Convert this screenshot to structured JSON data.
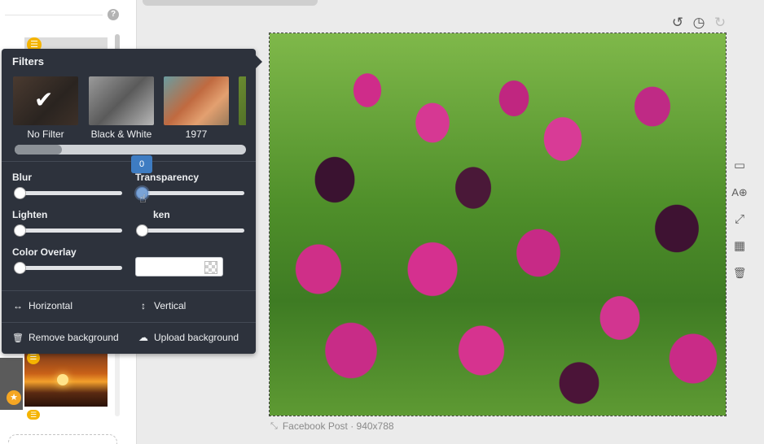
{
  "sidebar": {
    "help_icon": "?",
    "badge_icon": "☰",
    "star_icon": "★"
  },
  "history": {
    "undo_icon": "↺",
    "history_icon": "◷",
    "redo_icon": "↻"
  },
  "canvas": {
    "caption_icon": "⤡",
    "caption": "Facebook Post · 940x788"
  },
  "tools": {
    "page_icon": "▭",
    "text_icon": "A⊕",
    "resize_icon": "⤢",
    "grid_icon": "▦",
    "trash_icon": "🗑"
  },
  "filters_panel": {
    "title": "Filters",
    "filters": [
      {
        "name": "No Filter",
        "selected": true
      },
      {
        "name": "Black & White",
        "selected": false
      },
      {
        "name": "1977",
        "selected": false
      },
      {
        "name": "",
        "selected": false
      }
    ],
    "check_icon": "✔",
    "adjustments": {
      "blur": {
        "label": "Blur",
        "value": 0
      },
      "transparency": {
        "label": "Transparency",
        "value": 0,
        "tooltip": "0"
      },
      "lighten": {
        "label": "Lighten",
        "value": 0
      },
      "darken": {
        "label": "ken",
        "value": 0
      },
      "color_overlay": {
        "label": "Color Overlay",
        "value": 0,
        "color": ""
      }
    },
    "flip": {
      "horizontal": {
        "icon": "↔",
        "label": "Horizontal"
      },
      "vertical": {
        "icon": "↕",
        "label": "Vertical"
      }
    },
    "background": {
      "remove": {
        "icon": "🗑",
        "label": "Remove background"
      },
      "upload": {
        "icon": "☁",
        "label": "Upload background"
      }
    }
  },
  "colors": {
    "panel_bg": "#2d323c",
    "accent": "#3e7cc2",
    "badge": "#f5b400"
  }
}
